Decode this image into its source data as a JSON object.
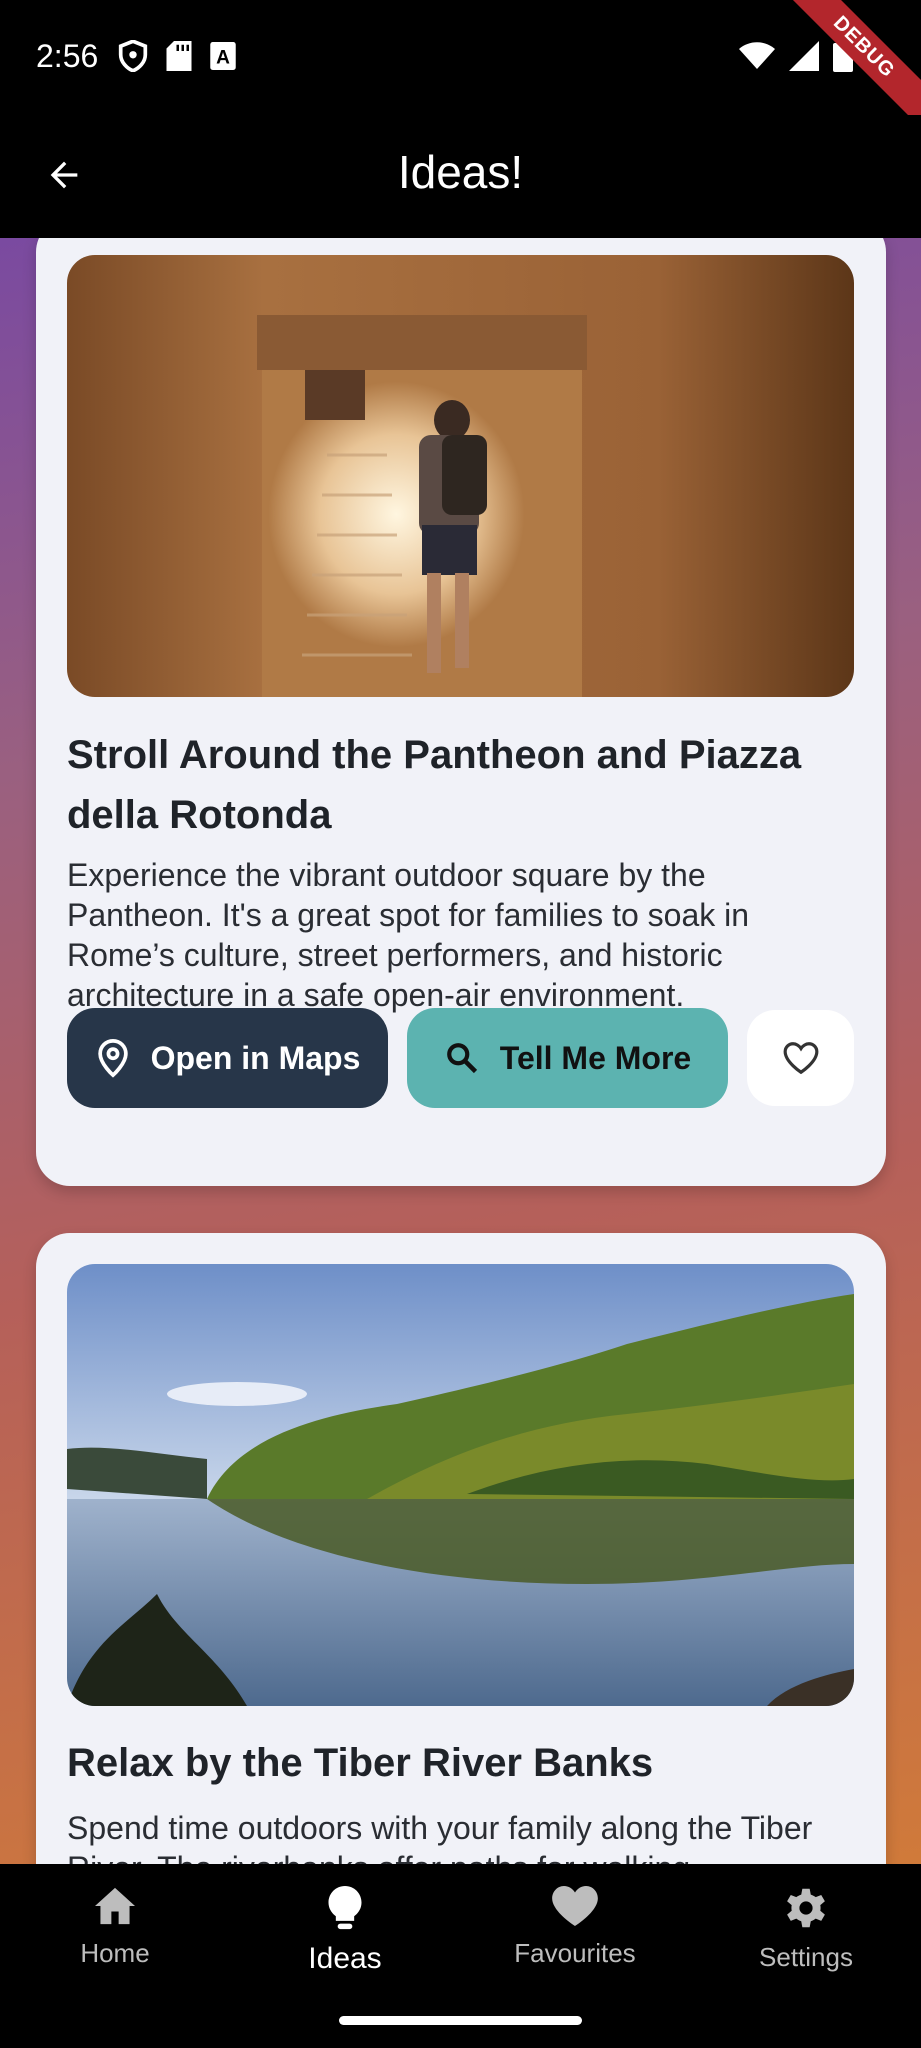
{
  "status": {
    "time": "2:56",
    "debug_label": "DEBUG",
    "left_icons": [
      "shield-icon",
      "sd-card-icon",
      "font-icon"
    ],
    "right_icons": [
      "wifi-icon",
      "signal-icon",
      "battery-icon"
    ]
  },
  "app_bar": {
    "title": "Ideas!",
    "back_icon": "arrow-back-icon"
  },
  "cards": [
    {
      "title": "Stroll Around the Pantheon and Piazza della Rotonda",
      "description": "Experience the vibrant outdoor square by the Pantheon. It's a great spot for families to soak in Rome’s culture, street performers, and historic architecture in a safe open-air environment.",
      "maps_label": "Open in Maps",
      "more_label": "Tell Me More",
      "favourite": false
    },
    {
      "title": "Relax by the Tiber River Banks",
      "description": "Spend time outdoors with your family along the Tiber River. The riverbanks offer paths for walking"
    }
  ],
  "nav": {
    "items": [
      {
        "label": "Home",
        "icon": "home-icon",
        "active": false
      },
      {
        "label": "Ideas",
        "icon": "lightbulb-icon",
        "active": true
      },
      {
        "label": "Favourites",
        "icon": "heart-icon",
        "active": false
      },
      {
        "label": "Settings",
        "icon": "gear-icon",
        "active": false
      }
    ]
  },
  "colors": {
    "maps_button": "#273649",
    "more_button": "#5cb3b0",
    "card_bg": "#f1f2f8",
    "gradient_top": "#7a4aa0",
    "gradient_bottom": "#d07a3a"
  }
}
